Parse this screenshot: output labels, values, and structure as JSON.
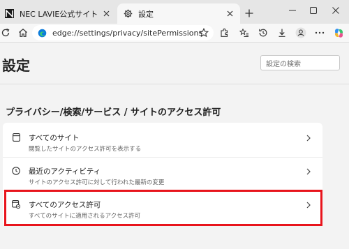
{
  "browser": {
    "tabs": [
      {
        "title": "NEC LAVIE公式サイト > サービス＆サ",
        "icon": "nec-favicon-icon",
        "active": false
      },
      {
        "title": "設定",
        "icon": "gear-icon",
        "active": true
      }
    ],
    "address_url": "edge://settings/privacy/sitePermissions"
  },
  "settings": {
    "page_title": "設定",
    "search_placeholder": "設定の検索",
    "section_heading": "プライバシー/検索/サービス  /  サイトのアクセス許可",
    "rows": [
      {
        "icon": "site-page-icon",
        "label": "すべてのサイト",
        "description": "閲覧したサイトのアクセス許可を表示する"
      },
      {
        "icon": "clock-icon",
        "label": "最近のアクティビティ",
        "description": "サイトのアクセス許可に対して行われた最新の変更"
      },
      {
        "icon": "site-settings-icon",
        "label": "すべてのアクセス許可",
        "description": "すべてのサイトに適用されるアクセス許可",
        "highlighted": true
      }
    ]
  },
  "colors": {
    "highlight_border": "#e8141c",
    "edge_accent": "#0c7bdc"
  }
}
